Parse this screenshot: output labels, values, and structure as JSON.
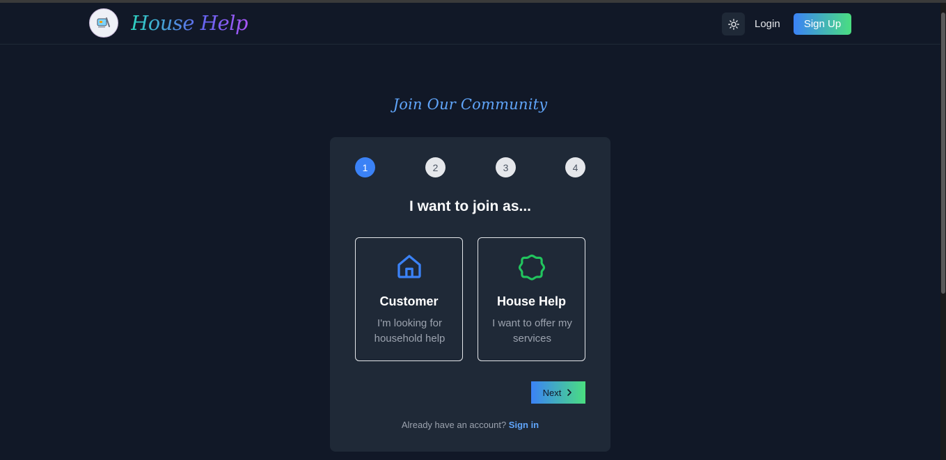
{
  "nav": {
    "brand": "House Help",
    "login_label": "Login",
    "signup_label": "Sign Up",
    "theme_icon": "sun-icon"
  },
  "main": {
    "heading": "Join Our Community"
  },
  "stepper": {
    "steps": [
      "1",
      "2",
      "3",
      "4"
    ],
    "active_step": 1
  },
  "form": {
    "title": "I want to join as...",
    "options": [
      {
        "title": "Customer",
        "description": "I'm looking for household help",
        "icon": "house-icon",
        "icon_color": "#3b82f6"
      },
      {
        "title": "House Help",
        "description": "I want to offer my services",
        "icon": "badge-icon",
        "icon_color": "#22c55e"
      }
    ],
    "next_label": "Next",
    "signin_prompt": "Already have an account?",
    "signin_link": "Sign in"
  },
  "colors": {
    "background": "#111827",
    "card": "#1f2937",
    "accent_blue": "#3b82f6",
    "accent_green": "#4ade80"
  }
}
